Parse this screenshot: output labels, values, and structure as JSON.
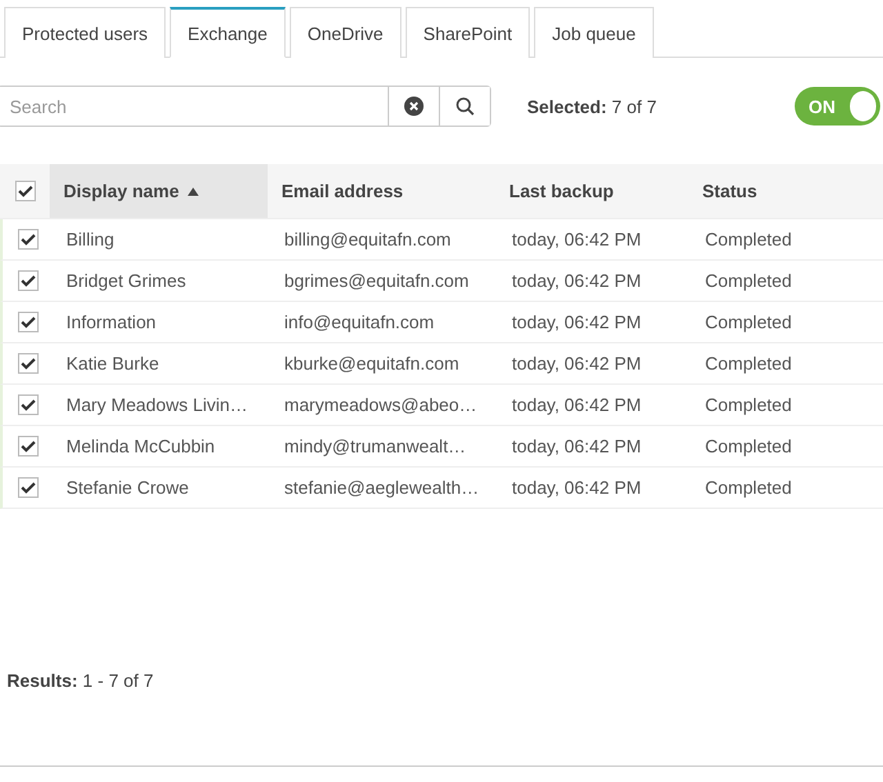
{
  "tabs": [
    {
      "label": "Protected users",
      "selected": false
    },
    {
      "label": "Exchange",
      "selected": true
    },
    {
      "label": "OneDrive",
      "selected": false
    },
    {
      "label": "SharePoint",
      "selected": false
    },
    {
      "label": "Job queue",
      "selected": false
    }
  ],
  "search": {
    "placeholder": "Search"
  },
  "selection": "**Selected:** 7 of 7",
  "toggle": {
    "label": "ON",
    "on": true
  },
  "table": {
    "all_checked": true,
    "columns": [
      {
        "label": "Display name",
        "sorted": true
      },
      {
        "label": "Email address",
        "sorted": false
      },
      {
        "label": "Last backup",
        "sorted": false
      },
      {
        "label": "Status",
        "sorted": false
      }
    ],
    "rows": [
      {
        "checked": true,
        "cells": [
          "Billing",
          "billing@equitafn.com",
          "today, 06:42 PM",
          "Completed"
        ]
      },
      {
        "checked": true,
        "cells": [
          "Bridget Grimes",
          "bgrimes@equitafn.com",
          "today, 06:42 PM",
          "Completed"
        ]
      },
      {
        "checked": true,
        "cells": [
          "Information",
          "info@equitafn.com",
          "today, 06:42 PM",
          "Completed"
        ]
      },
      {
        "checked": true,
        "cells": [
          "Katie Burke",
          "kburke@equitafn.com",
          "today, 06:42 PM",
          "Completed"
        ]
      },
      {
        "checked": true,
        "cells": [
          "Mary Meadows Livin…",
          "marymeadows@abeo…",
          "today, 06:42 PM",
          "Completed"
        ]
      },
      {
        "checked": true,
        "cells": [
          "Melinda McCubbin",
          "mindy@trumanwealt…",
          "today, 06:42 PM",
          "Completed"
        ]
      },
      {
        "checked": true,
        "cells": [
          "Stefanie Crowe",
          "stefanie@aeglewealth…",
          "today, 06:42 PM",
          "Completed"
        ]
      }
    ]
  },
  "results": "**Results:** 1 - 7 of 7"
}
